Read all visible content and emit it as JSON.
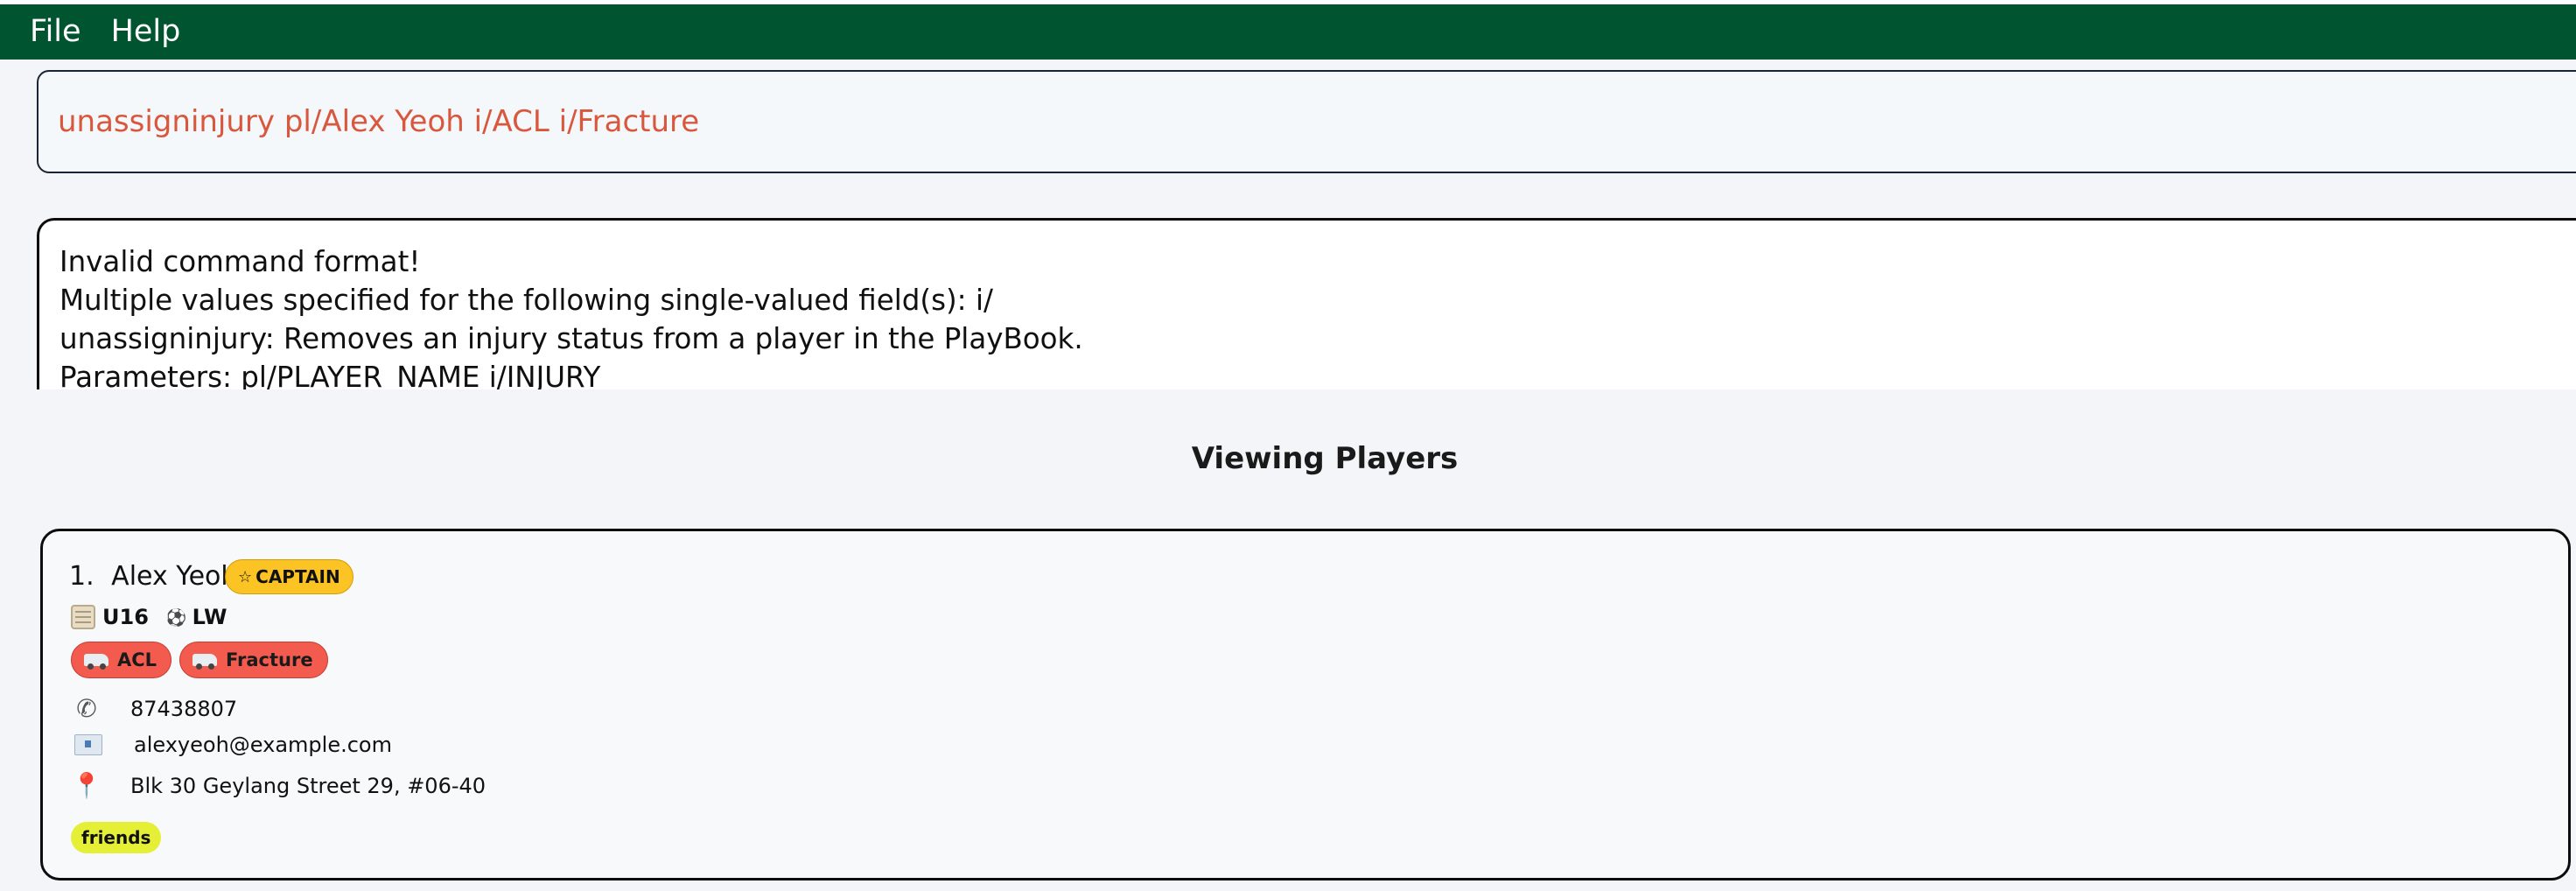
{
  "menu": {
    "file": "File",
    "help": "Help"
  },
  "command": {
    "value": "unassigninjury pl/Alex Yeoh i/ACL i/Fracture"
  },
  "result": {
    "lines": [
      "Invalid command format!",
      "Multiple values specified for the following single-valued field(s): i/",
      "unassigninjury: Removes an injury status from a player in the PlayBook.",
      "Parameters: pl/PLAYER_NAME i/INJURY"
    ]
  },
  "list": {
    "title": "Viewing Players"
  },
  "players": [
    {
      "index": "1.",
      "name": "Alex Yeoh",
      "captain_label": "CAPTAIN",
      "team": "U16",
      "position": "LW",
      "injuries": [
        "ACL",
        "Fracture"
      ],
      "phone": "87438807",
      "email": "alexyeoh@example.com",
      "address": "Blk 30 Geylang Street 29, #06-40",
      "tags": [
        "friends"
      ]
    }
  ],
  "icons": {
    "captain": "star-icon",
    "team": "calendar-icon",
    "position": "soccer-ball-icon",
    "injury": "ambulance-icon",
    "phone": "phone-icon",
    "email": "email-icon",
    "address": "pin-icon"
  },
  "colors": {
    "menubar": "#005430",
    "command_text": "#d9573d",
    "captain_badge": "#fbc424",
    "injury_tag": "#f25b4d",
    "friends_tag": "#e5ef35"
  }
}
